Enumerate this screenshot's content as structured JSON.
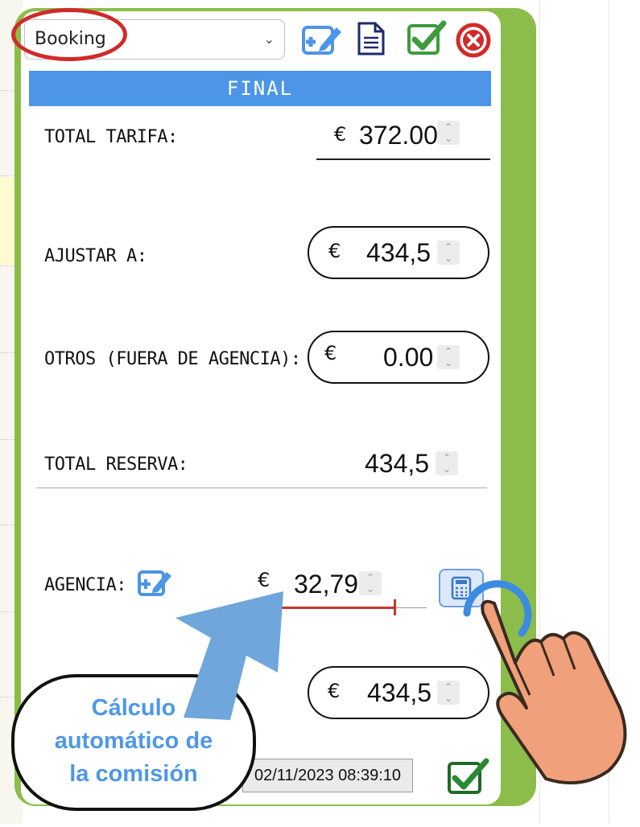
{
  "agency_select": {
    "value": "Booking",
    "chevron": "⌄"
  },
  "toolbar": {
    "icons": [
      "edit-plus-icon",
      "document-icon",
      "check-icon",
      "close-icon"
    ]
  },
  "header": {
    "title": "FINAL"
  },
  "rows": {
    "total_tarifa": {
      "label": "TOTAL TARIFA:",
      "currency": "€",
      "value": "372.00"
    },
    "ajustar_a": {
      "label": "AJUSTAR A:",
      "currency": "€",
      "value": "434,5"
    },
    "otros": {
      "label": "OTROS (FUERA DE AGENCIA):",
      "currency": "€",
      "value": "0.00"
    },
    "total_reserva": {
      "label": "TOTAL RESERVA:",
      "value": "434,5"
    },
    "agencia": {
      "label": "AGENCIA:",
      "currency": "€",
      "value": "32,79"
    },
    "final_total": {
      "currency": "€",
      "value": "434,5"
    }
  },
  "spinner": {
    "up": "⌃",
    "down": "⌄"
  },
  "footer": {
    "timestamp": "02/11/2023 08:39:10"
  },
  "annotation": {
    "callout_lines": [
      "Cálculo",
      "automático de",
      "la comisión"
    ]
  },
  "colors": {
    "accent_blue": "#4d95e6",
    "frame_green": "#8cbd4a",
    "ok_green": "#3e9b3e",
    "close_red": "#d12a2a",
    "callout_blue": "#4f98e4",
    "hand_skin": "#f0a07a"
  }
}
